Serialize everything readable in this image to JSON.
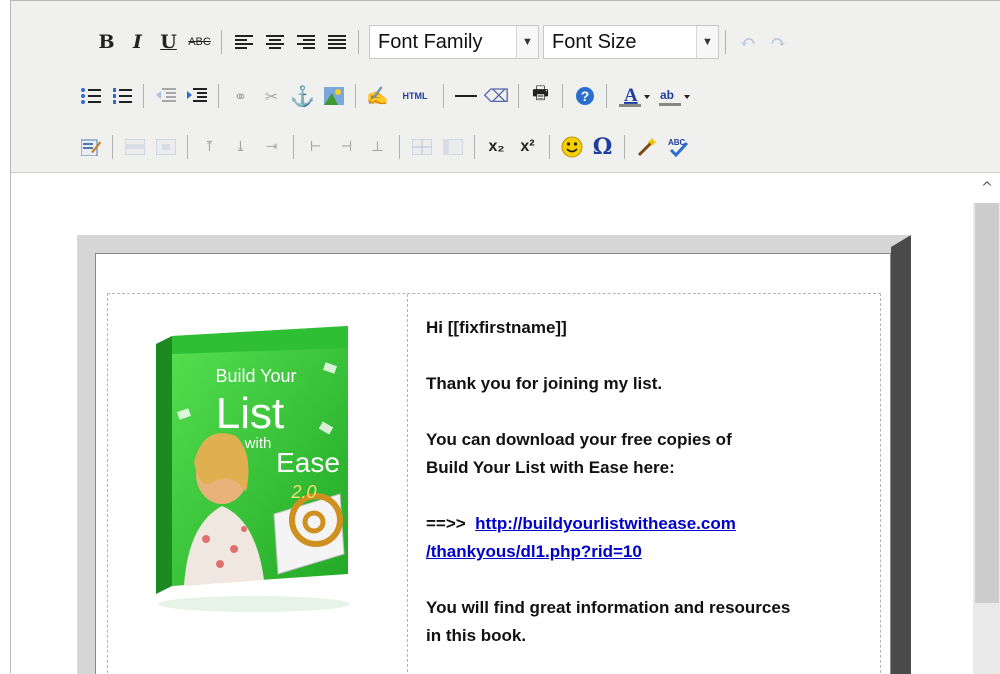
{
  "toolbar": {
    "font_family_label": "Font Family",
    "font_size_label": "Font Size",
    "bold": "B",
    "italic": "I",
    "underline": "U",
    "strike": "ABC",
    "html_label": "HTML",
    "subscript": "x₂",
    "superscript": "x²",
    "omega": "Ω",
    "icons": [
      "bold-icon",
      "italic-icon",
      "underline-icon",
      "strikethrough-icon",
      "align-left-icon",
      "align-center-icon",
      "align-right-icon",
      "align-justify-icon",
      "undo-icon",
      "redo-icon",
      "bullet-list-icon",
      "numbered-list-icon",
      "outdent-icon",
      "indent-icon",
      "link-icon",
      "unlink-icon",
      "anchor-icon",
      "image-icon",
      "cleanup-icon",
      "html-icon",
      "horizontal-rule-icon",
      "eraser-icon",
      "print-icon",
      "help-icon",
      "text-color-icon",
      "highlight-color-icon",
      "edit-icon",
      "table-icon",
      "subscript-icon",
      "superscript-icon",
      "emoticon-icon",
      "special-char-icon",
      "wand-icon",
      "spellcheck-icon"
    ]
  },
  "book": {
    "cover_title_line1": "Build Your",
    "cover_title_line2": "List",
    "cover_title_line3": "with",
    "cover_title_line4": "Ease",
    "cover_version": "2.0",
    "colors": {
      "cover_green": "#38c93a",
      "cover_dark_green": "#1c8a20"
    }
  },
  "email": {
    "greeting": "Hi [[fixfirstname]]",
    "thanks": "Thank you for joining my list.",
    "download_line1": "You can download your free copies of",
    "download_line2": "Build Your List with Ease here:",
    "arrow": "==>>",
    "link_line1": "http://buildyourlistwithease.com",
    "link_line2": "/thankyous/dl1.php?rid=10",
    "resources_line1": "You will find great information and resources",
    "resources_line2": "in this book."
  }
}
